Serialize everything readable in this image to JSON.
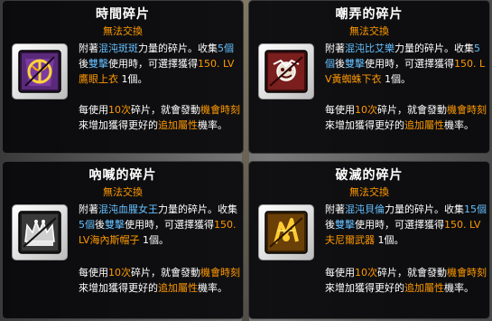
{
  "tooltips": [
    {
      "title": "時間碎片",
      "untradeable": "無法交換",
      "desc": {
        "p1": "附著",
        "boss": "混沌斑斑",
        "p2": "力量的碎片。收集",
        "count": "5個",
        "p3": "後",
        "use": "雙擊",
        "p4": "使用時，可選擇獲得",
        "reward": "150. LV鷹眼上衣",
        "p5": " 1個。"
      },
      "icon": "hourglass-shard-icon"
    },
    {
      "title": "嘲弄的碎片",
      "untradeable": "無法交換",
      "desc": {
        "p1": "附著",
        "boss": "混沌比艾樂",
        "p2": "力量的碎片。收集",
        "count": "5個",
        "p3": "後",
        "use": "雙擊",
        "p4": "使用時，可選擇獲得",
        "reward": "150. LV黃蜘蛛下衣",
        "p5": " 1個。"
      },
      "icon": "jester-shard-icon"
    },
    {
      "title": "吶喊的碎片",
      "untradeable": "無法交換",
      "desc": {
        "p1": "附著",
        "boss": "混沌血腥女王",
        "p2": "力量的碎片。收集",
        "count": "5個",
        "p3": "後",
        "use": "雙擊",
        "p4": "使用時，可選擇獲得",
        "reward": "150. LV海內斯帽子",
        "p5": " 1個。"
      },
      "icon": "crown-shard-icon"
    },
    {
      "title": "破滅的碎片",
      "untradeable": "無法交換",
      "desc": {
        "p1": "附著",
        "boss": "混沌貝倫",
        "p2": "力量的碎片。收集",
        "count": "15個",
        "p3": "後",
        "use": "雙擊",
        "p4": "使用時，可選擇獲得",
        "reward": "150. LV夫尼爾武器",
        "p5": " 1個。"
      },
      "icon": "ruin-shard-icon"
    }
  ],
  "common": {
    "b1": "每使用",
    "per": "10次",
    "b2": "碎片，就會發動",
    "skill": "機會時刻",
    "b3": "來增加獲得更好的",
    "bonus": "追加屬性",
    "b4": "機率。"
  },
  "colors": {
    "title": "#ffffff",
    "untradeable": "#ff9900",
    "highlight_cyan": "#66c0ff",
    "highlight_orange": "#ff9900"
  }
}
